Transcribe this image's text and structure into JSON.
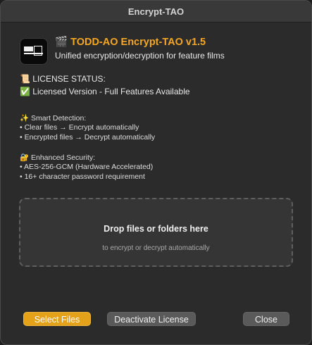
{
  "window": {
    "title": "Encrypt-TAO"
  },
  "app": {
    "icon": "clapperboard-icon",
    "name_emoji": "🎬",
    "name": "TODD-AO Encrypt-TAO v1.5",
    "subtitle": "Unified encryption/decryption for feature films"
  },
  "license": {
    "heading_emoji": "📜",
    "heading": "LICENSE STATUS:",
    "status_emoji": "✅",
    "status": "Licensed Version - Full Features Available"
  },
  "smart_detection": {
    "emoji": "✨",
    "heading": "Smart Detection:",
    "items": [
      "• Clear files → Encrypt automatically",
      "• Encrypted files → Decrypt automatically"
    ]
  },
  "security": {
    "emoji": "🔐",
    "heading": "Enhanced Security:",
    "items": [
      "• AES-256-GCM (Hardware Accelerated)",
      "• 16+ character password requirement"
    ]
  },
  "dropzone": {
    "title": "Drop files or folders here",
    "subtitle": "to encrypt or decrypt automatically"
  },
  "buttons": {
    "select_files": "Select Files",
    "deactivate": "Deactivate License",
    "close": "Close"
  },
  "colors": {
    "accent": "#f5a623",
    "primary_button": "#e3a21a",
    "window_bg": "#2b2b2b"
  }
}
